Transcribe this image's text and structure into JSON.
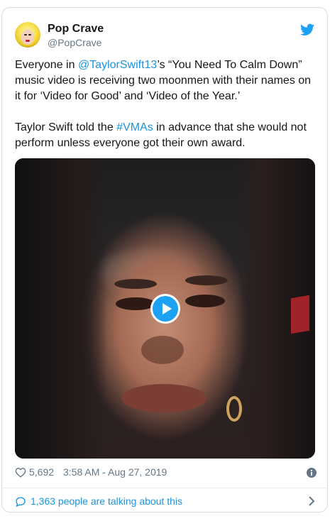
{
  "tweet": {
    "author_name": "Pop Crave",
    "author_handle": "@PopCrave",
    "text_parts": {
      "p1_a": "Everyone in ",
      "p1_mention": "@TaylorSwift13",
      "p1_b": "’s “You Need To Calm Down” music video is receiving two moonmen with their names on it for ‘Video for Good’ and ‘Video of the Year.’",
      "p2_a": "Taylor Swift told the ",
      "p2_hashtag": "#VMAs",
      "p2_b": " in advance that she would not perform unless everyone got their own award."
    },
    "likes": "5,692",
    "timestamp": "3:58 AM - Aug 27, 2019",
    "talking": "1,363 people are talking about this"
  },
  "icons": {
    "brand": "twitter-bird-icon",
    "play": "play-icon",
    "like": "heart-icon",
    "info": "info-icon",
    "reply": "speech-bubble-icon",
    "more": "chevron-right-icon"
  },
  "colors": {
    "link": "#1b95e0",
    "twitter_blue": "#1da1f2",
    "secondary_text": "#657786"
  }
}
